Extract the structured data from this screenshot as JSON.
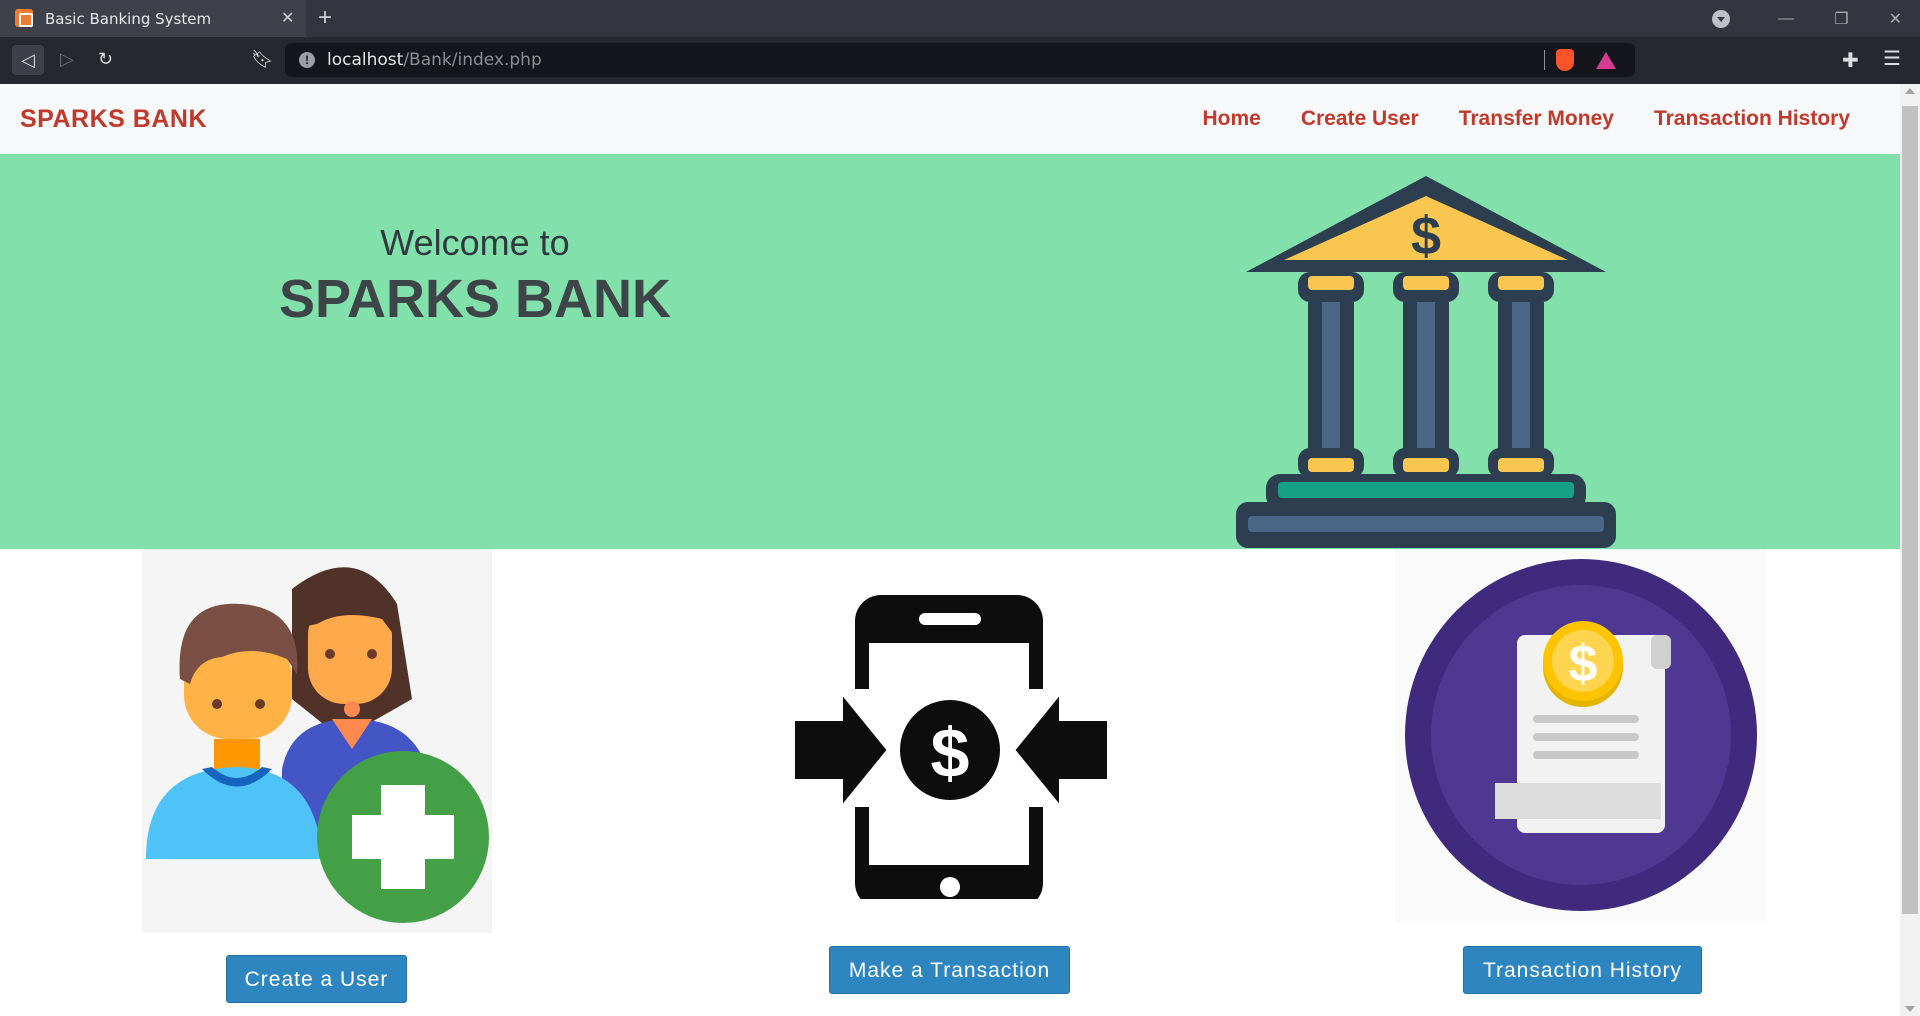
{
  "browser": {
    "tab_title": "Basic Banking System",
    "url_host": "localhost",
    "url_path": "/Bank/index.php"
  },
  "navbar": {
    "brand": "SPARKS BANK",
    "links": [
      "Home",
      "Create User",
      "Transfer Money",
      "Transaction History"
    ]
  },
  "hero": {
    "welcome": "Welcome to",
    "title": "SPARKS BANK"
  },
  "cards": {
    "create_user_button": "Create a User",
    "transaction_button": "Make a Transaction",
    "history_button": "Transaction History"
  },
  "icons": {
    "currency_symbol": "$"
  },
  "colors": {
    "brand_red": "#c0392b",
    "hero_green": "#82e0aa",
    "button_blue": "#2e86c1"
  }
}
